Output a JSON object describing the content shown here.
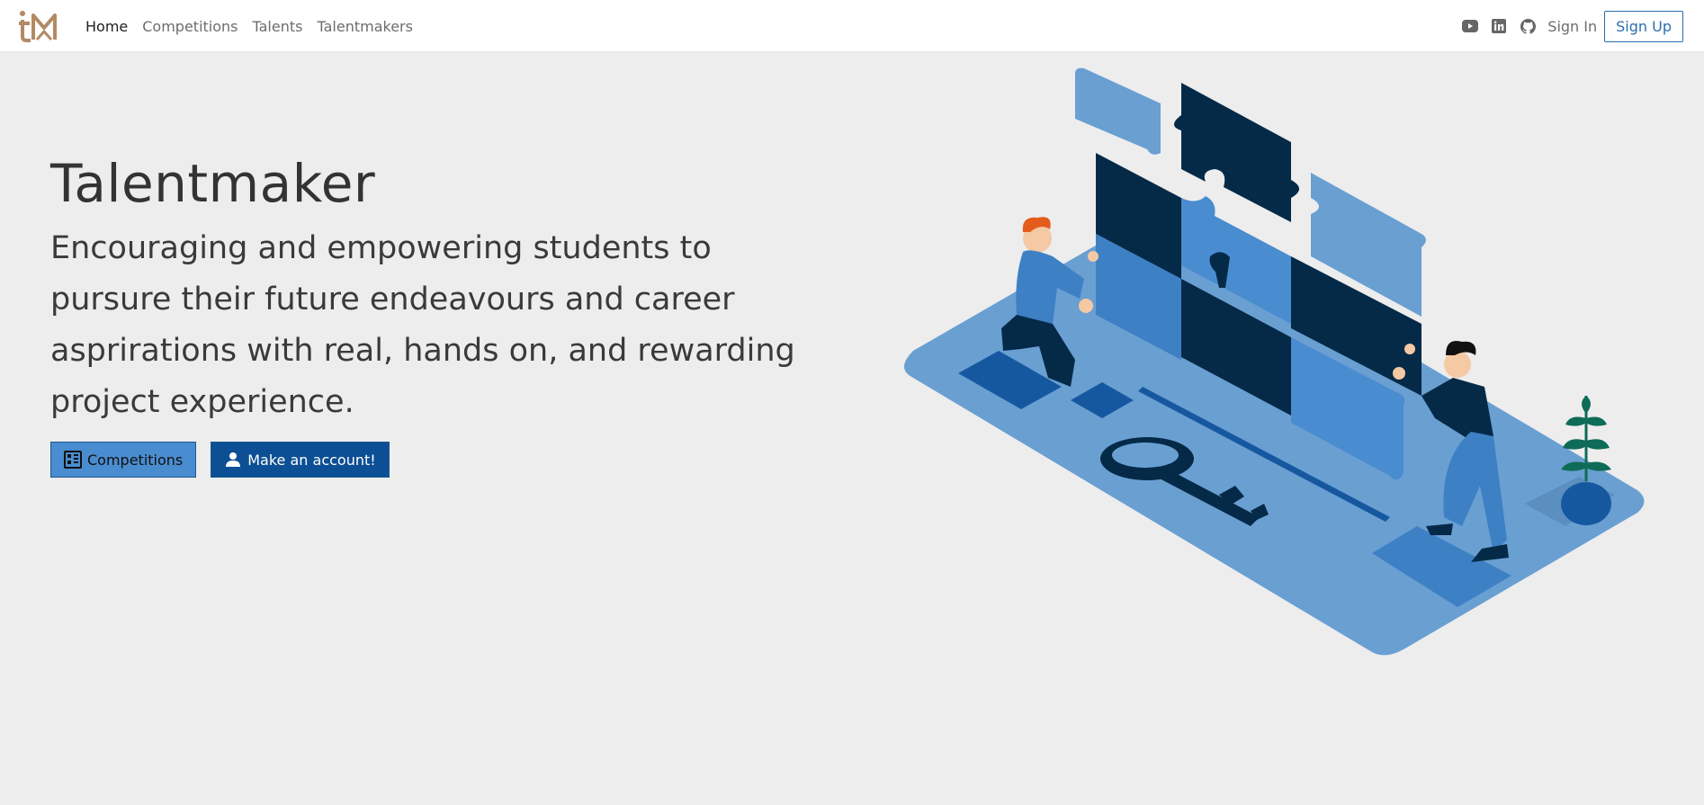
{
  "nav": {
    "logo_alt": "tM",
    "links": [
      {
        "label": "Home",
        "active": true
      },
      {
        "label": "Competitions",
        "active": false
      },
      {
        "label": "Talents",
        "active": false
      },
      {
        "label": "Talentmakers",
        "active": false
      }
    ],
    "social_icons": [
      "youtube-icon",
      "linkedin-icon",
      "github-icon"
    ],
    "signin_label": "Sign In",
    "signup_label": "Sign Up"
  },
  "hero": {
    "title": "Talentmaker",
    "subtitle": "Encouraging and empowering students to pursure their future endeavours and career asprirations with real, hands on, and rewarding project experience.",
    "buttons": {
      "competitions_label": "Competitions",
      "account_label": "Make an account!"
    }
  },
  "colors": {
    "background": "#ededed",
    "accent_blue": "#4a8cd0",
    "dark_blue": "#0d4f94",
    "logo_brown": "#b38a64",
    "puzzle_navy": "#052a48"
  }
}
